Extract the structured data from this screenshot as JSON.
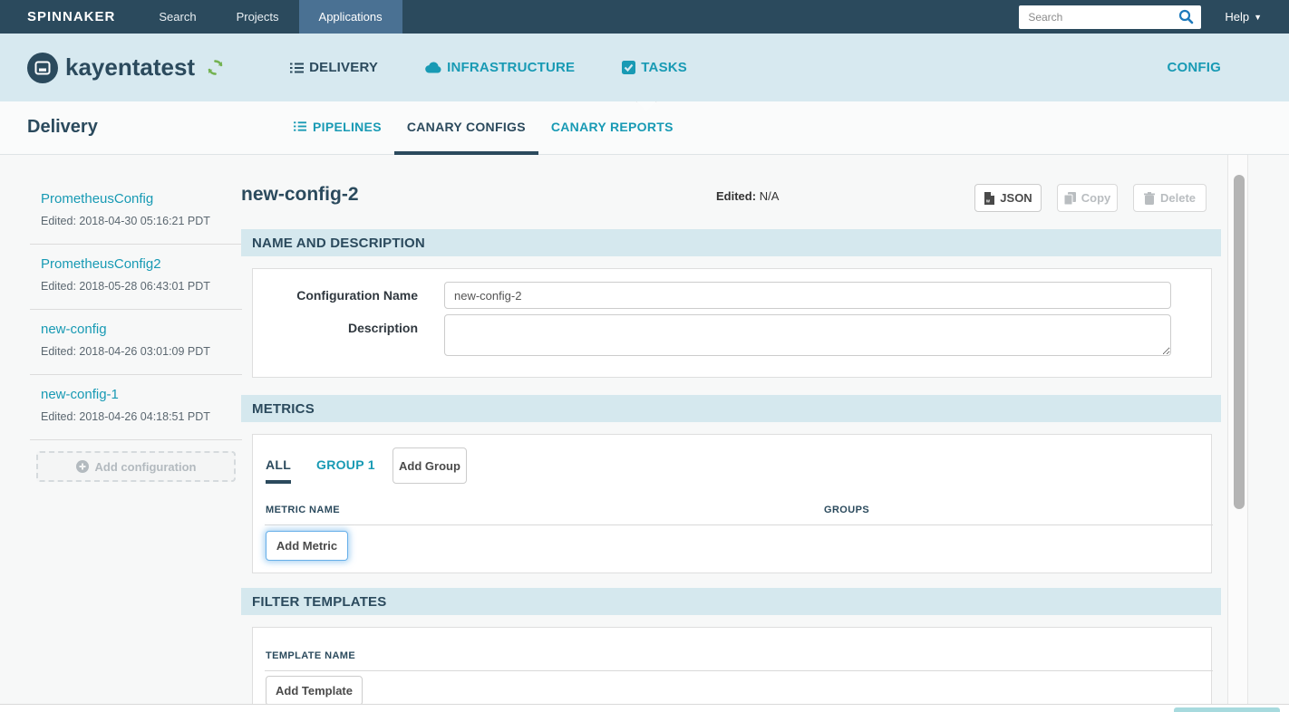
{
  "topnav": {
    "brand": "SPINNAKER",
    "items": [
      {
        "label": "Search",
        "active": false
      },
      {
        "label": "Projects",
        "active": false
      },
      {
        "label": "Applications",
        "active": true
      }
    ],
    "search_placeholder": "Search",
    "help_label": "Help"
  },
  "appbar": {
    "app_name": "kayentatest",
    "tabs": [
      {
        "label": "DELIVERY",
        "icon": "list-icon",
        "active": true
      },
      {
        "label": "INFRASTRUCTURE",
        "icon": "cloud-icon",
        "active": false
      },
      {
        "label": "TASKS",
        "icon": "check-square-icon",
        "active": false
      }
    ],
    "config_label": "CONFIG"
  },
  "delivery": {
    "heading": "Delivery",
    "tabs": [
      {
        "label": "PIPELINES",
        "icon": "list-icon",
        "active": false
      },
      {
        "label": "CANARY CONFIGS",
        "active": true
      },
      {
        "label": "CANARY REPORTS",
        "active": false
      }
    ]
  },
  "sidebar": {
    "configs": [
      {
        "name": "PrometheusConfig",
        "edited": "Edited: 2018-04-30 05:16:21 PDT"
      },
      {
        "name": "PrometheusConfig2",
        "edited": "Edited: 2018-05-28 06:43:01 PDT"
      },
      {
        "name": "new-config",
        "edited": "Edited: 2018-04-26 03:01:09 PDT"
      },
      {
        "name": "new-config-1",
        "edited": "Edited: 2018-04-26 04:18:51 PDT"
      }
    ],
    "add_button": "Add configuration"
  },
  "config_detail": {
    "title": "new-config-2",
    "edited_label": "Edited:",
    "edited_value": "N/A",
    "buttons": {
      "json": "JSON",
      "copy": "Copy",
      "delete": "Delete"
    },
    "sections": {
      "name_desc": {
        "header": "NAME AND DESCRIPTION",
        "name_label": "Configuration Name",
        "name_value": "new-config-2",
        "desc_label": "Description",
        "desc_value": ""
      },
      "metrics": {
        "header": "METRICS",
        "tabs": [
          "ALL",
          "GROUP 1"
        ],
        "add_group": "Add Group",
        "columns": [
          "METRIC NAME",
          "GROUPS"
        ],
        "add_metric": "Add Metric"
      },
      "filter_templates": {
        "header": "FILTER TEMPLATES",
        "columns": [
          "TEMPLATE NAME"
        ],
        "add_template": "Add Template"
      }
    }
  },
  "colors": {
    "nav_dark": "#2b4a5d",
    "nav_active": "#4a7193",
    "app_bar_bg": "#d7e9f0",
    "accent_teal": "#189ab4",
    "refresh_green": "#73b251",
    "section_bar_bg": "#d5e8ee",
    "focus_ring": "#66afe9",
    "toast_teal": "#a7dade"
  }
}
